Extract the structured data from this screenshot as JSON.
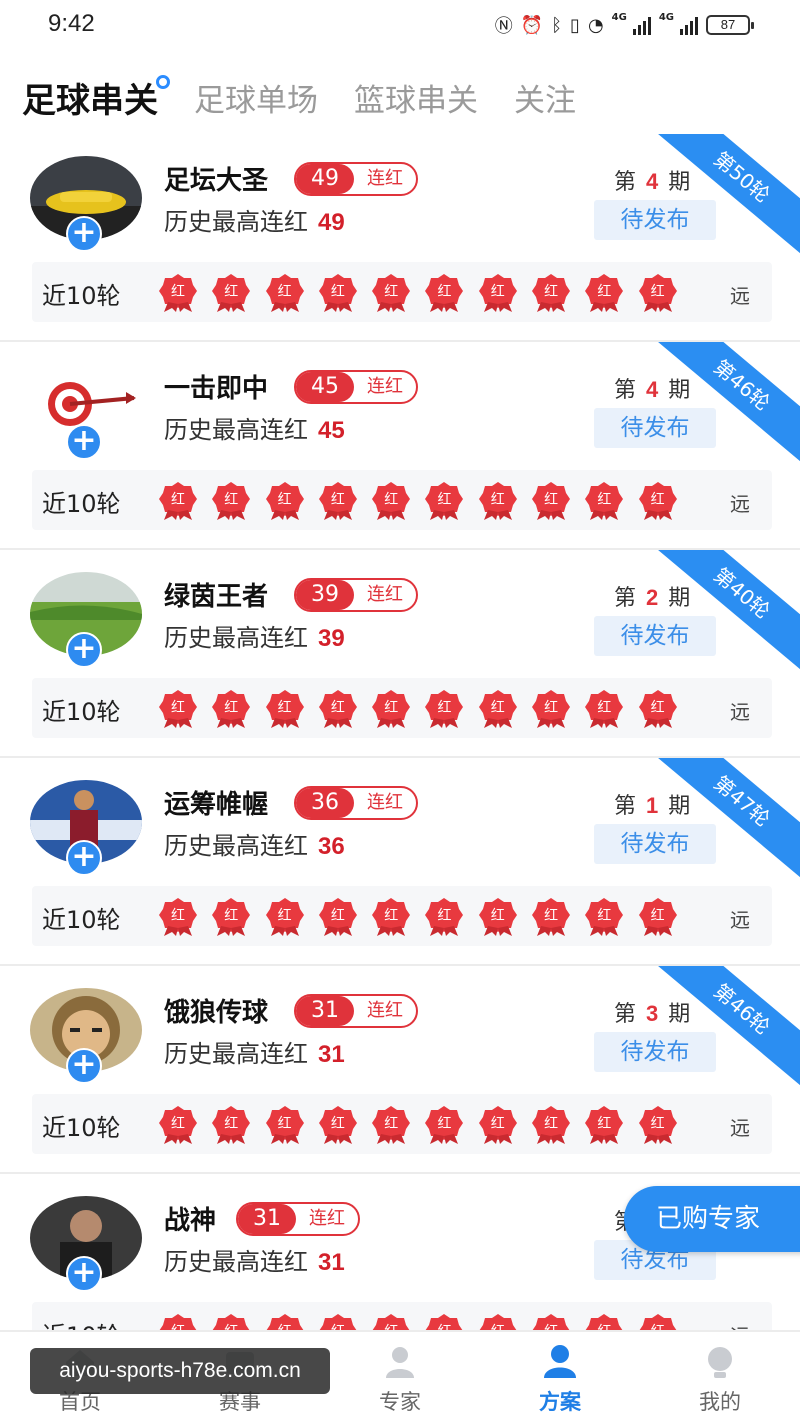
{
  "status": {
    "time": "9:42",
    "net1": "4G",
    "net2": "4G",
    "battery": "87"
  },
  "tabs": [
    {
      "label": "足球串关",
      "active": true
    },
    {
      "label": "足球单场",
      "active": false
    },
    {
      "label": "篮球串关",
      "active": false
    },
    {
      "label": "关注",
      "active": false
    }
  ],
  "common": {
    "streak_label": "连红",
    "history_label": "历史最高连红",
    "period_prefix": "第",
    "period_suffix": "期",
    "pending_label": "待发布",
    "recent_label": "近10轮",
    "badge_text": "红",
    "more_label": "远"
  },
  "experts": [
    {
      "name": "足坛大圣",
      "streak": "49",
      "best": "49",
      "period": "4",
      "round": "第50轮"
    },
    {
      "name": "一击即中",
      "streak": "45",
      "best": "45",
      "period": "4",
      "round": "第46轮"
    },
    {
      "name": "绿茵王者",
      "streak": "39",
      "best": "39",
      "period": "2",
      "round": "第40轮"
    },
    {
      "name": "运筹帷幄",
      "streak": "36",
      "best": "36",
      "period": "1",
      "round": "第47轮"
    },
    {
      "name": "饿狼传球",
      "streak": "31",
      "best": "31",
      "period": "3",
      "round": "第46轮"
    },
    {
      "name": "战神",
      "streak": "31",
      "best": "31",
      "period": "",
      "round": ""
    }
  ],
  "float_button": "已购专家",
  "bottom_nav": [
    {
      "label": "首页",
      "icon": "home-icon"
    },
    {
      "label": "赛事",
      "icon": "match-icon"
    },
    {
      "label": "专家",
      "icon": "expert-icon"
    },
    {
      "label": "方案",
      "icon": "plan-icon"
    },
    {
      "label": "我的",
      "icon": "profile-icon"
    }
  ],
  "active_nav": "方案",
  "watermark": "aiyou-sports-h78e.com.cn",
  "colors": {
    "accent_blue": "#2b8ef2",
    "streak_red": "#e0333b",
    "badge_red": "#e8393f"
  }
}
